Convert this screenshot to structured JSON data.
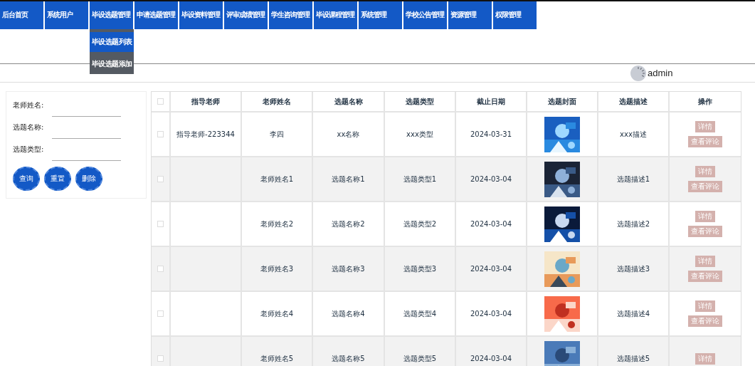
{
  "nav": [
    {
      "label": "后台首页"
    },
    {
      "label": "系统用户"
    },
    {
      "label": "毕设选题管理",
      "expanded": true,
      "submenu": [
        {
          "label": "毕设选题列表",
          "selected": true
        },
        {
          "label": "毕设选题添加",
          "selected": false
        }
      ]
    },
    {
      "label": "申请选题管理"
    },
    {
      "label": "毕设资料管理"
    },
    {
      "label": "评审成绩管理"
    },
    {
      "label": "学生咨询管理"
    },
    {
      "label": "毕设课程管理"
    },
    {
      "label": "系统管理"
    },
    {
      "label": "学校公告管理"
    },
    {
      "label": "资源管理"
    },
    {
      "label": "权限管理"
    }
  ],
  "user": {
    "name": "admin"
  },
  "search": {
    "fields": [
      {
        "label": "老师姓名:"
      },
      {
        "label": "选题名称:"
      },
      {
        "label": "选题类型:"
      }
    ],
    "buttons": [
      "查询",
      "重置",
      "删除"
    ]
  },
  "table": {
    "header_checked": false,
    "columns": [
      "指导老师",
      "老师姓名",
      "选题名称",
      "选题类型",
      "截止日期",
      "选题封面",
      "选题描述",
      "操作"
    ],
    "rows": [
      {
        "checked": false,
        "cells": [
          "指导老师-223344",
          "李四",
          "xx名称",
          "xxx类型",
          "2024-03-31"
        ],
        "cover": {
          "kind": "picture"
        },
        "description": "xxx描述",
        "actions": [
          "详情",
          "查看评论"
        ]
      },
      {
        "checked": false,
        "cells": [
          "",
          "老师姓名1",
          "选题名称1",
          "选题类型1",
          "2024-03-04"
        ],
        "cover": {
          "kind": "picture"
        },
        "description": "选题描述1",
        "actions": [
          "详情",
          "查看评论"
        ]
      },
      {
        "checked": false,
        "cells": [
          "",
          "老师姓名2",
          "选题名称2",
          "选题类型2",
          "2024-03-04"
        ],
        "cover": {
          "kind": "picture"
        },
        "description": "选题描述2",
        "actions": [
          "详情",
          "查看评论"
        ]
      },
      {
        "checked": false,
        "cells": [
          "",
          "老师姓名3",
          "选题名称3",
          "选题类型3",
          "2024-03-04"
        ],
        "cover": {
          "kind": "picture"
        },
        "description": "选题描述3",
        "actions": [
          "详情",
          "查看评论"
        ]
      },
      {
        "checked": false,
        "cells": [
          "",
          "老师姓名4",
          "选题名称4",
          "选题类型4",
          "2024-03-04"
        ],
        "cover": {
          "kind": "picture"
        },
        "description": "选题描述4",
        "actions": [
          "详情",
          "查看评论"
        ]
      },
      {
        "checked": false,
        "cells": [
          "",
          "老师姓名5",
          "选题名称5",
          "选题类型5",
          "2024-03-04"
        ],
        "cover": {
          "kind": "picture"
        },
        "description": "选题描述5",
        "actions": [
          "详情"
        ]
      }
    ]
  }
}
